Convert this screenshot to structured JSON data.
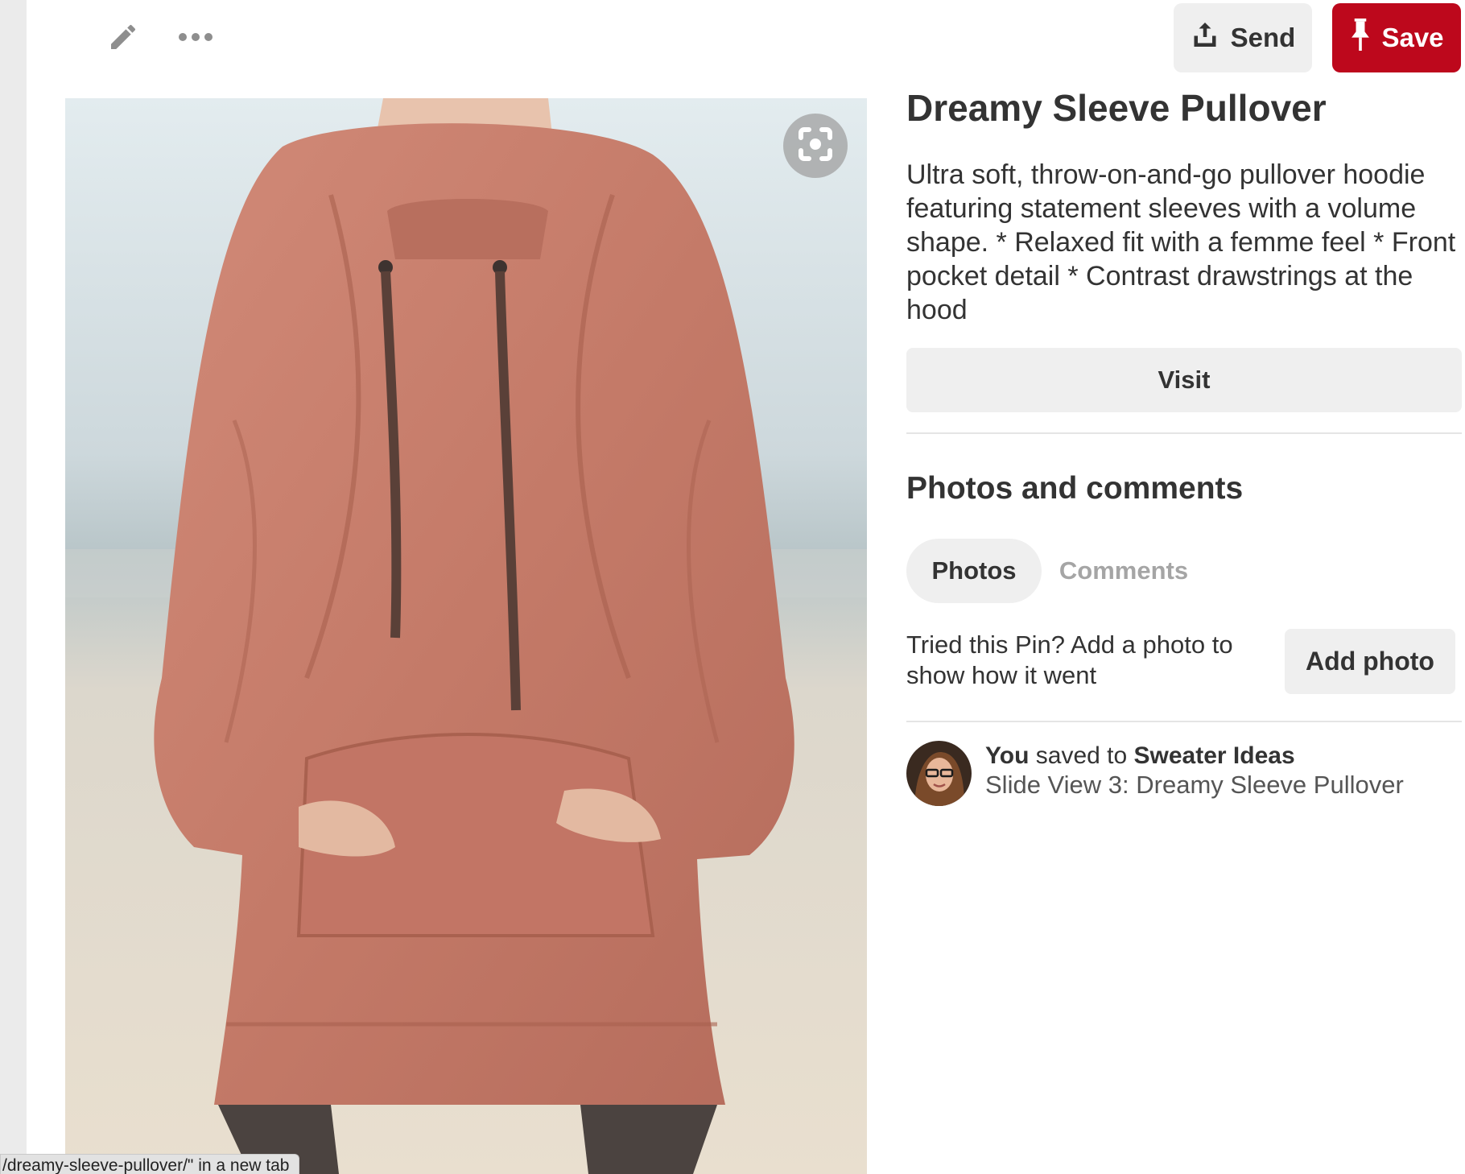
{
  "toolbar": {
    "edit_icon": "pencil-icon",
    "more_icon": "ellipsis-icon",
    "send_label": "Send",
    "send_icon": "share-upload-icon",
    "save_label": "Save",
    "save_icon": "pushpin-icon",
    "save_color": "#bd081c"
  },
  "pin": {
    "image_alt": "Pink oversized pullover hoodie",
    "lens_icon": "visual-search-icon",
    "title": "Dreamy Sleeve Pullover",
    "description": "Ultra soft, throw-on-and-go pullover hoodie featuring statement sleeves with a volume shape. * Relaxed fit with a femme feel * Front pocket detail * Contrast drawstrings at the hood",
    "visit_label": "Visit"
  },
  "photos_comments": {
    "heading": "Photos and comments",
    "tabs": [
      {
        "label": "Photos",
        "active": true
      },
      {
        "label": "Comments",
        "active": false
      }
    ],
    "tried_prompt": "Tried this Pin? Add a photo to show how it went",
    "add_photo_label": "Add photo"
  },
  "activity": {
    "actor": "You",
    "verb": " saved to ",
    "board": "Sweater Ideas",
    "saved_title": "Slide View 3: Dreamy Sleeve Pullover"
  },
  "status_bar": {
    "text": "/dreamy-sleeve-pullover/\" in a new tab"
  }
}
